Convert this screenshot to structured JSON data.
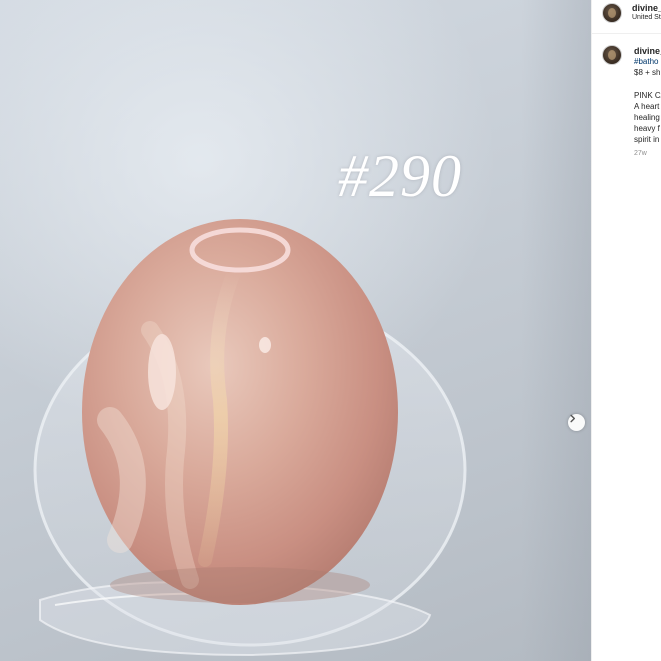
{
  "post": {
    "image_overlay_text": "#290",
    "next_icon": "chevron-right-icon"
  },
  "header": {
    "username": "divine_c",
    "location": "United St"
  },
  "caption": {
    "username": "divine_",
    "hashtag": "#batho",
    "price": "$8 + sh",
    "title": "PINK CA",
    "lines": [
      "A heart",
      "healing",
      "heavy f",
      "spirit in"
    ],
    "time": "27w"
  }
}
